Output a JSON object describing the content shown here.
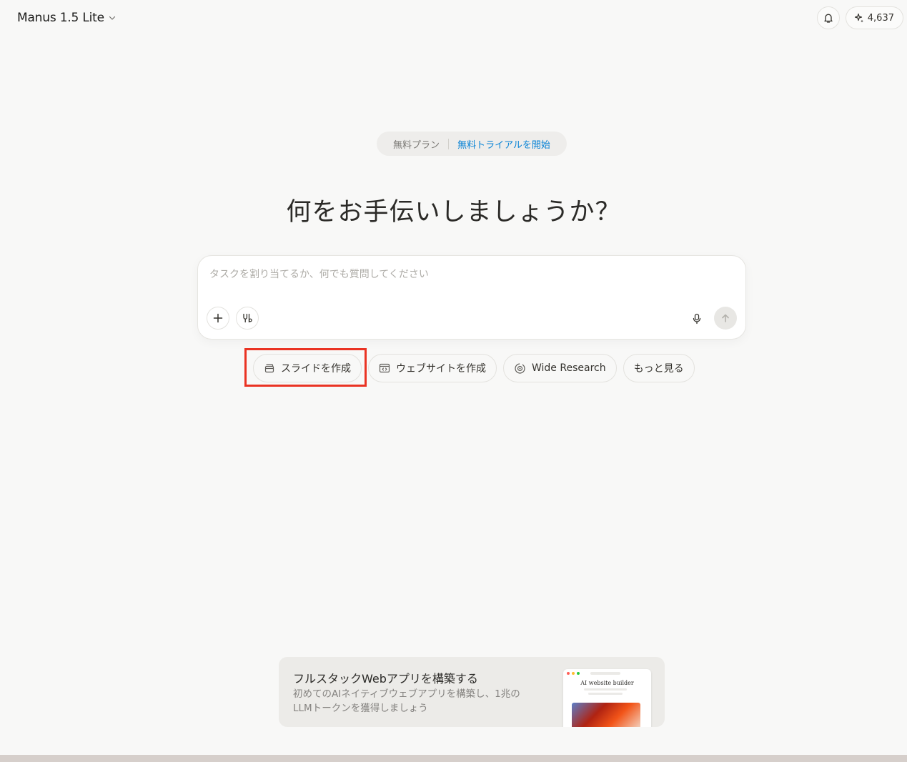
{
  "header": {
    "model_name": "Manus 1.5 Lite",
    "credits": "4,637",
    "icons": {
      "model_dropdown": "chevron-down-icon",
      "notifications": "bell-icon",
      "credits": "sparkle-icon"
    }
  },
  "plan_banner": {
    "plan_label": "無料プラン",
    "trial_link": "無料トライアルを開始"
  },
  "main": {
    "heading": "何をお手伝いしましょうか？"
  },
  "composer": {
    "placeholder": "タスクを割り当てるか、何でも質問してください",
    "value": "",
    "icons": {
      "attach": "plus-icon",
      "tools": "connectors-icon",
      "mic": "microphone-icon",
      "send": "arrow-up-icon"
    }
  },
  "quick_actions": [
    {
      "label": "スライドを作成",
      "icon": "slides-icon",
      "highlighted": true
    },
    {
      "label": "ウェブサイトを作成",
      "icon": "code-window-icon",
      "highlighted": false
    },
    {
      "label": "Wide Research",
      "icon": "research-globe-icon",
      "highlighted": false
    },
    {
      "label": "もっと見る",
      "icon": "",
      "highlighted": false
    }
  ],
  "promo_card": {
    "title": "フルスタックWebアプリを構築する",
    "description": "初めてのAIネイティブウェブアプリを構築し、1兆のLLMトークンを獲得しましょう",
    "thumbnail_title": "AI website builder"
  },
  "colors": {
    "background": "#f8f8f7",
    "accent_link": "#0a84d6",
    "highlight_box": "#ea3323"
  }
}
